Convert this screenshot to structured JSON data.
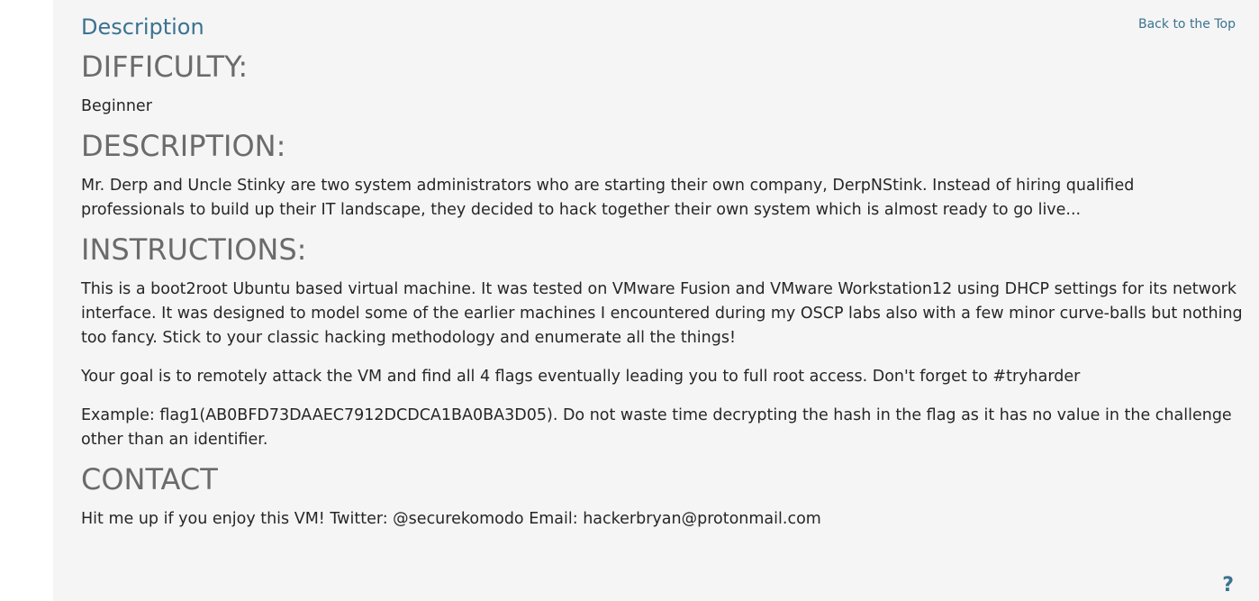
{
  "header": {
    "section_title": "Description",
    "back_to_top": "Back to the Top"
  },
  "difficulty": {
    "heading": "DIFFICULTY:",
    "value": "Beginner"
  },
  "description": {
    "heading": "DESCRIPTION:",
    "text": "Mr. Derp and Uncle Stinky are two system administrators who are starting their own company, DerpNStink. Instead of hiring qualified professionals to build up their IT landscape, they decided to hack together their own system which is almost ready to go live..."
  },
  "instructions": {
    "heading": "INSTRUCTIONS:",
    "paragraphs": [
      "This is a boot2root Ubuntu based virtual machine. It was tested on VMware Fusion and VMware Workstation12 using DHCP settings for its network interface. It was designed to model some of the earlier machines I encountered during my OSCP labs also with a few minor curve-balls but nothing too fancy. Stick to your classic hacking methodology and enumerate all the things!",
      "Your goal is to remotely attack the VM and find all 4 flags eventually leading you to full root access. Don't forget to #tryharder",
      "Example: flag1(AB0BFD73DAAEC7912DCDCA1BA0BA3D05). Do not waste time decrypting the hash in the flag as it has no value in the challenge other than an identifier."
    ]
  },
  "contact": {
    "heading": "CONTACT",
    "text": "Hit me up if you enjoy this VM! Twitter: @securekomodo Email: hackerbryan@protonmail.com"
  },
  "help": {
    "icon": "question-mark-icon",
    "glyph": "?"
  },
  "colors": {
    "accent": "#3b7391",
    "heading": "#6b6b6b",
    "text": "#262626",
    "panel_bg": "#f5f5f5"
  }
}
